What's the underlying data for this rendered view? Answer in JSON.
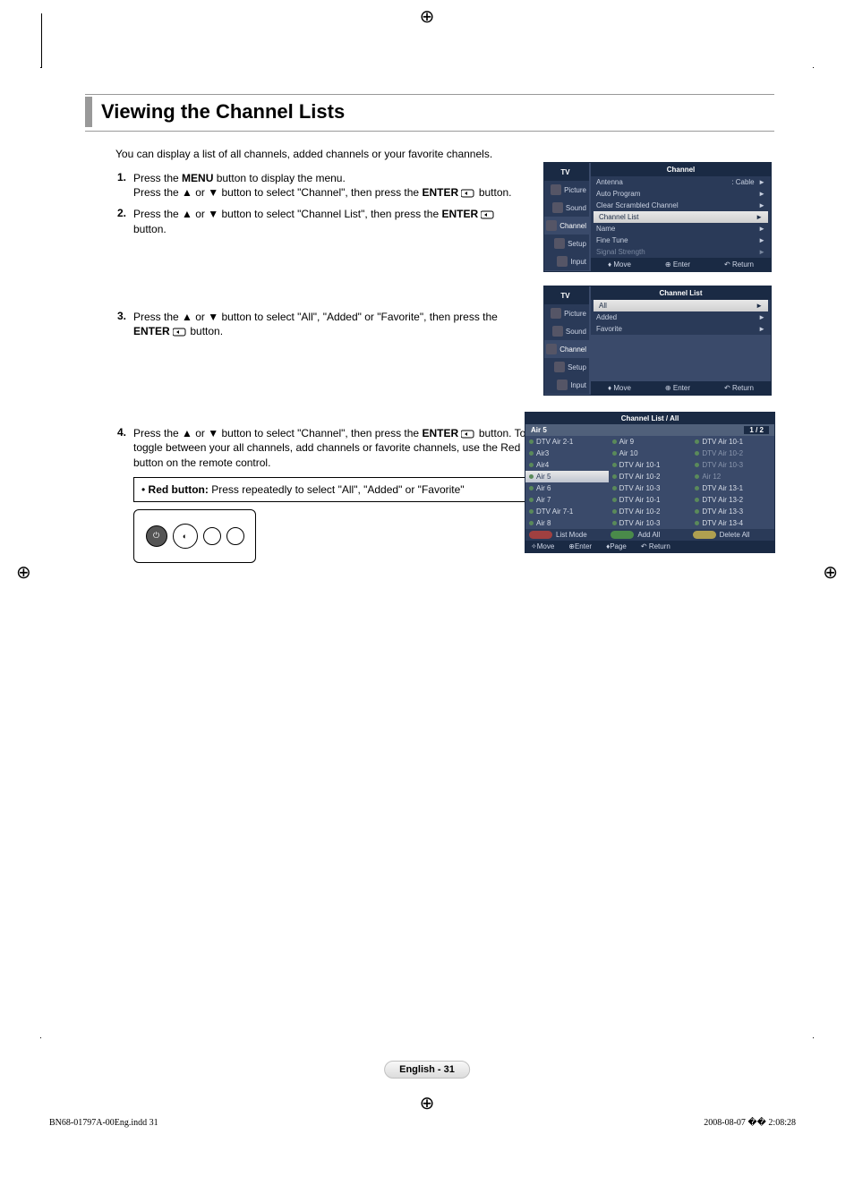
{
  "title": "Viewing the Channel Lists",
  "intro": "You can display a list of all channels, added channels or your favorite channels.",
  "enter_label": "ENTER",
  "menu_label": "MENU",
  "steps": {
    "s1a": "Press the ",
    "s1b": " button to display the menu.",
    "s1c": "Press the ▲ or ▼ button to select \"Channel\", then press the ",
    "s1d": " button.",
    "s2a": "Press the ▲ or ▼ button to select \"Channel List\", then press the ",
    "s2b": " button.",
    "s3a": "Press the ▲ or ▼ button to select \"All\", \"Added\" or \"Favorite\", then press the ",
    "s3b": " button.",
    "s4a": "Press the ▲ or ▼ button to select \"Channel\", then press the ",
    "s4b": " button. To toggle between your all channels, add channels or favorite channels, use the Red button on the remote control."
  },
  "nums": {
    "n1": "1.",
    "n2": "2.",
    "n3": "3.",
    "n4": "4."
  },
  "note": {
    "label": "Red button:",
    "text": " Press repeatedly to select \"All\", \"Added\" or \"Favorite\""
  },
  "osd_side": {
    "tv": "TV",
    "picture": "Picture",
    "sound": "Sound",
    "channel": "Channel",
    "setup": "Setup",
    "input": "Input"
  },
  "osd1": {
    "header": "Channel",
    "rows": {
      "antenna": "Antenna",
      "antenna_val": ": Cable",
      "autoprog": "Auto Program",
      "clear": "Clear Scrambled Channel",
      "chlist": "Channel List",
      "name": "Name",
      "fine": "Fine Tune",
      "signal": "Signal Strength"
    },
    "foot": {
      "move": "Move",
      "enter": "Enter",
      "return": "Return"
    }
  },
  "osd2": {
    "header": "Channel List",
    "rows": {
      "all": "All",
      "added": "Added",
      "fav": "Favorite"
    },
    "foot": {
      "move": "Move",
      "enter": "Enter",
      "return": "Return"
    }
  },
  "osd3": {
    "header": "Channel List / All",
    "sub_left": "Air 5",
    "sub_right": "1 / 2",
    "cells": [
      "DTV Air 2-1",
      "Air 9",
      "DTV Air 10-1",
      "Air3",
      "Air 10",
      "DTV Air 10-2",
      "Air4",
      "DTV Air 10-1",
      "DTV Air 10-3",
      "Air 5",
      "DTV Air 10-2",
      "Air 12",
      "Air 6",
      "DTV Air 10-3",
      "DTV Air 13-1",
      "Air 7",
      "DTV Air 10-1",
      "DTV Air 13-2",
      "DTV Air 7-1",
      "DTV Air 10-2",
      "DTV Air 13-3",
      "Air 8",
      "DTV Air 10-3",
      "DTV Air 13-4"
    ],
    "btns": {
      "list": "List Mode",
      "add": "Add All",
      "del": "Delete All"
    },
    "foot": {
      "move": "Move",
      "enter": "Enter",
      "page": "Page",
      "return": "Return"
    }
  },
  "page_num": "English - 31",
  "footer_left": "BN68-01797A-00Eng.indd   31",
  "footer_right": "2008-08-07   �� 2:08:28"
}
